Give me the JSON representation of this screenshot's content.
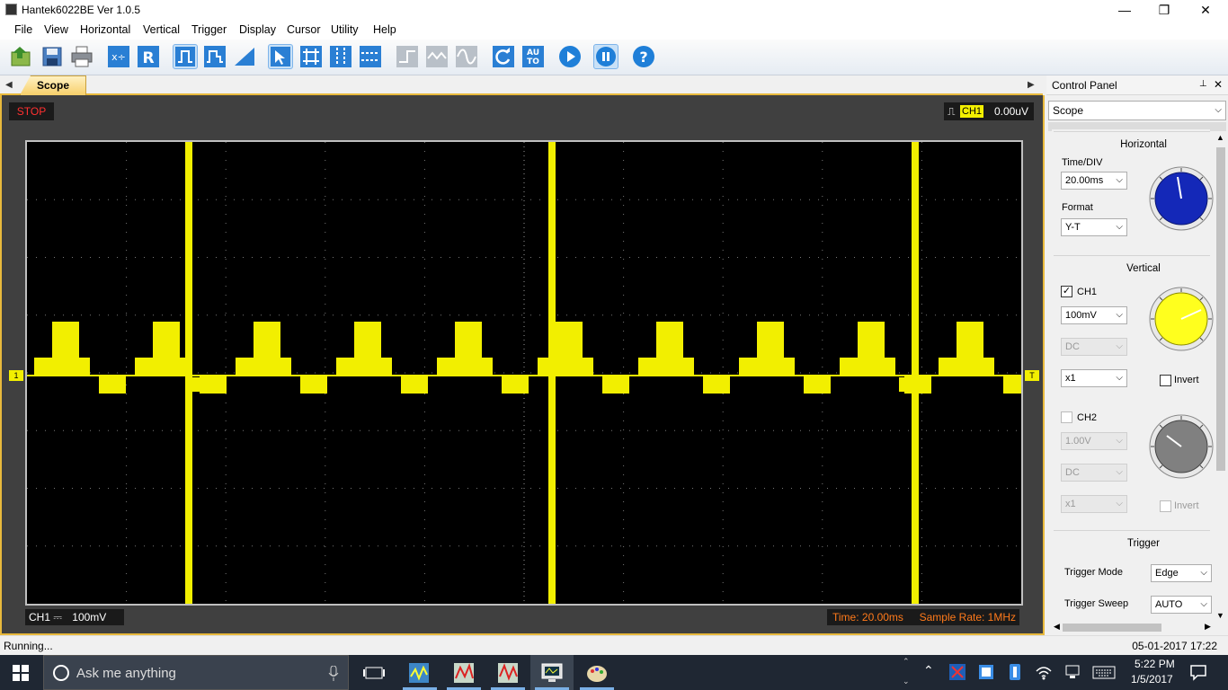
{
  "window": {
    "title": "Hantek6022BE Ver 1.0.5",
    "minimize_glyph": "—",
    "restore_glyph": "❐",
    "close_glyph": "✕"
  },
  "menu": [
    "File",
    "View",
    "Horizontal",
    "Vertical",
    "Trigger",
    "Display",
    "Cursor",
    "Utility",
    "Help"
  ],
  "toolbar": {
    "icons": [
      "open-icon",
      "save-icon",
      "print-icon",
      "math-icon",
      "reference-icon",
      "pulse-trigger-icon",
      "video-trigger-icon",
      "slope-trigger-icon",
      "select-icon",
      "grid-icon",
      "cursor-vertical-icon",
      "cursor-horizontal-icon",
      "step-icon",
      "wave-icon",
      "sine-icon",
      "refresh-icon",
      "auto-icon",
      "run-icon",
      "pause-icon",
      "help-icon"
    ],
    "auto_label": "AU\nTO",
    "help_label": "?"
  },
  "tabs": {
    "active": "Scope"
  },
  "scope": {
    "status": "STOP",
    "trigger_channel": "CH1",
    "trigger_level": "0.00uV",
    "ch1_label": "CH1",
    "ch1_coupling_glyph": "⎓",
    "ch1_scale": "100mV",
    "time_div": "Time: 20.00ms",
    "sample_rate": "Sample Rate: 1MHz",
    "ch1_marker": "1",
    "trigger_marker": "T",
    "trace_color": "#f2ef00"
  },
  "control_panel": {
    "title": "Control Panel",
    "mode": "Scope",
    "pin_glyph": "📌",
    "close_glyph": "✕",
    "horizontal": {
      "title": "Horizontal",
      "time_div_label": "Time/DIV",
      "time_div_value": "20.00ms",
      "format_label": "Format",
      "format_value": "Y-T",
      "knob_color": "#1428b8"
    },
    "vertical": {
      "title": "Vertical",
      "ch1": {
        "label": "CH1",
        "checked": true,
        "volts": "100mV",
        "coupling": "DC",
        "probe": "x1",
        "invert": "Invert",
        "knob_color": "#ffff1e"
      },
      "ch2": {
        "label": "CH2",
        "checked": false,
        "volts": "1.00V",
        "coupling": "DC",
        "probe": "x1",
        "invert": "Invert",
        "knob_color": "#808080"
      }
    },
    "trigger": {
      "title": "Trigger",
      "mode_label": "Trigger Mode",
      "mode_value": "Edge",
      "sweep_label": "Trigger Sweep",
      "sweep_value": "AUTO"
    }
  },
  "statusbar": {
    "left": "Running...",
    "right": "05-01-2017  17:22"
  },
  "taskbar": {
    "search_placeholder": "Ask me anything",
    "time": "5:22 PM",
    "date": "1/5/2017"
  }
}
